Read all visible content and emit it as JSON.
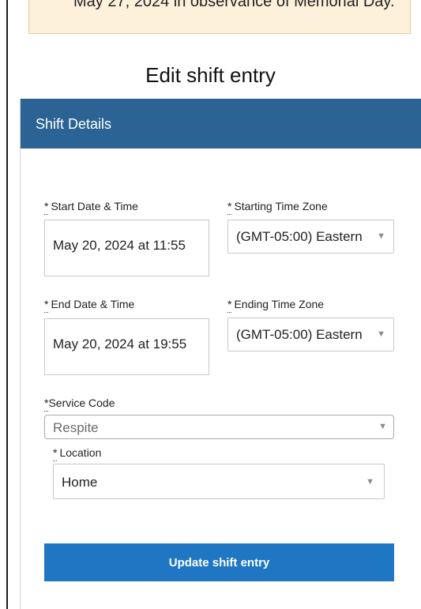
{
  "banner": {
    "text": "May 27, 2024 in observance of Memorial Day."
  },
  "page": {
    "title": "Edit shift entry"
  },
  "card": {
    "header": "Shift Details"
  },
  "form": {
    "required_marker": "*",
    "start_datetime": {
      "label": "Start Date & Time",
      "value": "May 20, 2024 at 11:55"
    },
    "start_timezone": {
      "label": "Starting Time Zone",
      "value": "(GMT-05:00) Eastern"
    },
    "end_datetime": {
      "label": "End Date & Time",
      "value": "May 20, 2024 at 19:55"
    },
    "end_timezone": {
      "label": "Ending Time Zone",
      "value": "(GMT-05:00) Eastern"
    },
    "service_code": {
      "label": "Service Code",
      "value": "Respite"
    },
    "location": {
      "label": "Location",
      "value": "Home"
    },
    "caret": "▼",
    "submit_label": "Update shift entry"
  },
  "colors": {
    "header_bg": "#2a6394",
    "button_bg": "#1f77c4",
    "banner_bg": "#fdf1dc"
  },
  "icons": {
    "dropdown": "chevron-down-icon"
  }
}
